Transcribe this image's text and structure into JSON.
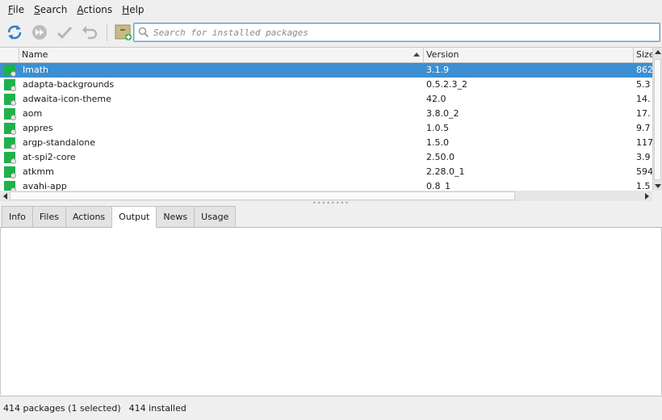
{
  "menubar": {
    "items": [
      {
        "ul": "F",
        "rest": "ile"
      },
      {
        "ul": "S",
        "rest": "earch"
      },
      {
        "ul": "A",
        "rest": "ctions"
      },
      {
        "ul": "H",
        "rest": "elp"
      }
    ]
  },
  "toolbar": {
    "icons": [
      "refresh-icon",
      "fast-forward-icon",
      "checkmark-icon",
      "undo-icon",
      "package-folder-icon"
    ],
    "accent": "#2f7fc8"
  },
  "search": {
    "placeholder": "Search for installed packages",
    "value": ""
  },
  "table": {
    "columns": {
      "name": "Name",
      "version": "Version",
      "size": "Size"
    },
    "rows": [
      {
        "name": "Imath",
        "version": "3.1.9",
        "size": "862"
      },
      {
        "name": "adapta-backgrounds",
        "version": "0.5.2.3_2",
        "size": "5.3"
      },
      {
        "name": "adwaita-icon-theme",
        "version": "42.0",
        "size": "14."
      },
      {
        "name": "aom",
        "version": "3.8.0_2",
        "size": "17."
      },
      {
        "name": "appres",
        "version": "1.0.5",
        "size": "9.7"
      },
      {
        "name": "argp-standalone",
        "version": "1.5.0",
        "size": "117"
      },
      {
        "name": "at-spi2-core",
        "version": "2.50.0",
        "size": "3.9"
      },
      {
        "name": "atkmm",
        "version": "2.28.0_1",
        "size": "594"
      },
      {
        "name": "avahi-app",
        "version": "0.8_1",
        "size": "1.5"
      }
    ],
    "selected_index": 0,
    "selection_color": "#3d8fd1",
    "package_icon_color": "#1fb14b"
  },
  "tabs": [
    {
      "label": "Info",
      "active": false
    },
    {
      "label": "Files",
      "active": false
    },
    {
      "label": "Actions",
      "active": false
    },
    {
      "label": "Output",
      "active": true
    },
    {
      "label": "News",
      "active": false
    },
    {
      "label": "Usage",
      "active": false
    }
  ],
  "status": {
    "packages": "414 packages (1 selected)",
    "installed": "414 installed"
  }
}
